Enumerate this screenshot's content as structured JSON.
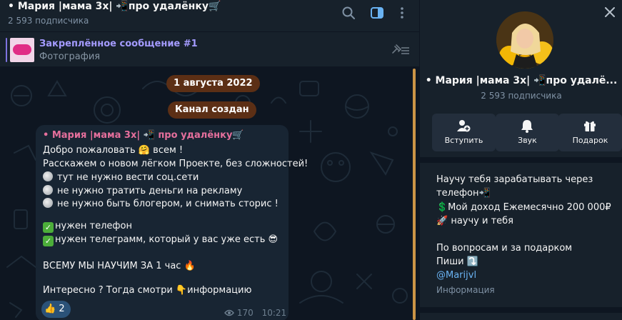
{
  "chat": {
    "title": "• Мария |мама 3х| 📲про удалёнку🛒",
    "subtitle": "2 593 подписчика",
    "header_icons": [
      "search-icon",
      "sidebar-toggle-icon",
      "more-vertical-icon"
    ]
  },
  "pinned": {
    "title": "Закреплённое сообщение #1",
    "subtitle": "Фотография"
  },
  "service": {
    "date": "1 августа 2022",
    "created": "Канал создан"
  },
  "message": {
    "author": "• Мария |мама 3х| 📲 про удалёнку🛒",
    "lines": [
      "Добро пожаловать 🤗 всем !",
      "Расскажем о новом лёгком Проекте, без сложностей!",
      "тут не нужно вести соц.сети",
      "не нужно тратить деньги  на рекламу",
      "не нужно быть блогером, и снимать сторис !",
      "нужен телефон",
      "нужен телеграмм, который у вас уже есть 😎",
      "ВСЕМУ МЫ НАУЧИМ ЗА 1 час 🔥",
      "Интересно ? Тогда смотри 👇информацию"
    ],
    "reaction_emoji": "👍",
    "reaction_count": "2",
    "views": "170",
    "time": "10:21"
  },
  "profile": {
    "name": "• Мария |мама 3х| 📲про удалё...",
    "subscribers": "2 593 подписчика",
    "buttons": {
      "join": "Вступить",
      "sound": "Звук",
      "gift": "Подарок"
    },
    "about_lines": [
      "Научу тебя зарабатывать через",
      "телефон📲",
      "💲Мой доход Ежемесячно 200 000₽",
      "🚀  научу и тебя",
      "По вопросам и за подарком",
      "Пиши ⤵️"
    ],
    "handle": "@Marijvl",
    "info_label": "Информация"
  },
  "colors": {
    "sidebar_bg": "#17212b",
    "chat_bg": "#0e1621",
    "bubble_bg": "#182533",
    "accent_link": "#6ab3f3",
    "author_pink": "#e56f9c",
    "pinned_purple": "#a49bff",
    "service_pill": "#5c2f15"
  }
}
